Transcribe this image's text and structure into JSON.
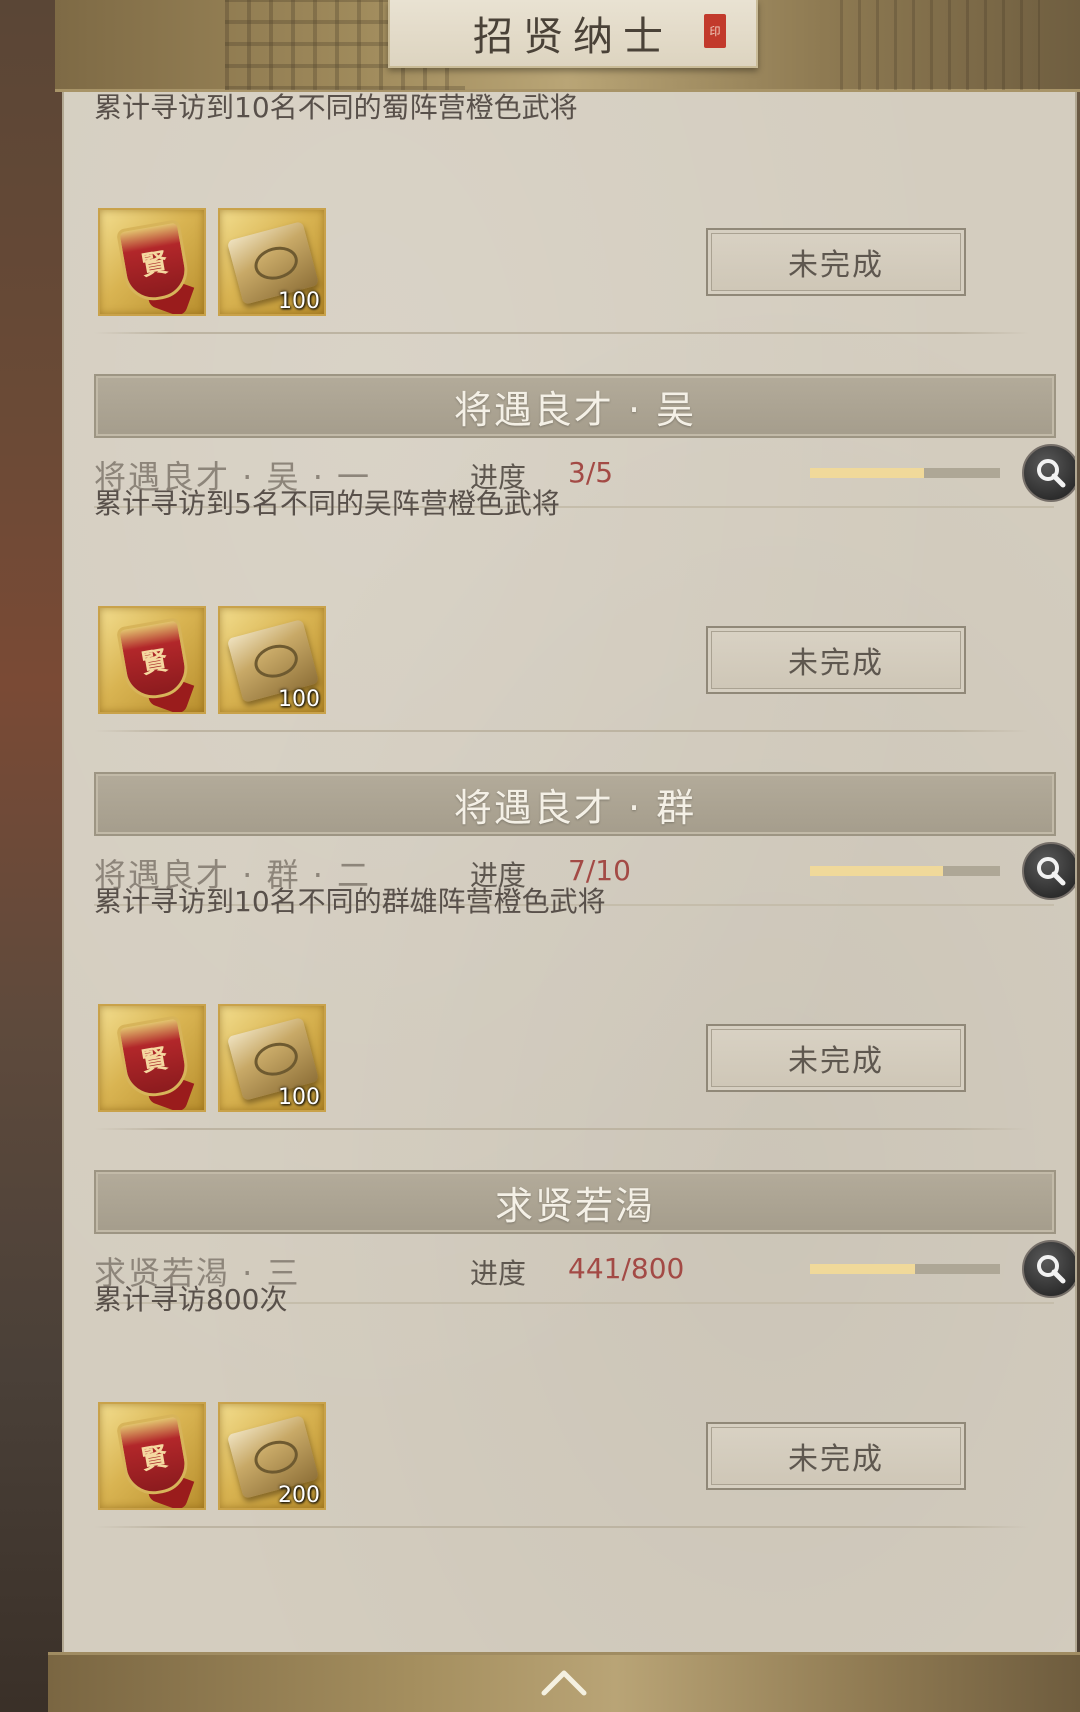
{
  "header": {
    "title": "招贤纳士",
    "seal_text": "印"
  },
  "sections": [
    {
      "description": "累计寻访到10名不同的蜀阵营橙色武将",
      "rewards": [
        {
          "icon": "red-badge-icon",
          "count": ""
        },
        {
          "icon": "gold-scroll-icon",
          "count": "100"
        }
      ],
      "status": "未完成"
    },
    {
      "header": "将遇良才 · 吴",
      "task": "将遇良才 · 吴 · 一",
      "progress_label": "进度",
      "progress_value": "3/5",
      "progress_fraction": 0.6,
      "description": "累计寻访到5名不同的吴阵营橙色武将",
      "rewards": [
        {
          "icon": "red-badge-icon",
          "count": ""
        },
        {
          "icon": "gold-scroll-icon",
          "count": "100"
        }
      ],
      "status": "未完成"
    },
    {
      "header": "将遇良才 · 群",
      "task": "将遇良才 · 群 · 二",
      "progress_label": "进度",
      "progress_value": "7/10",
      "progress_fraction": 0.7,
      "description": "累计寻访到10名不同的群雄阵营橙色武将",
      "rewards": [
        {
          "icon": "red-badge-icon",
          "count": ""
        },
        {
          "icon": "gold-scroll-icon",
          "count": "100"
        }
      ],
      "status": "未完成"
    },
    {
      "header": "求贤若渴",
      "task": "求贤若渴 · 三",
      "progress_label": "进度",
      "progress_value": "441/800",
      "progress_fraction": 0.55,
      "description": "累计寻访800次",
      "rewards": [
        {
          "icon": "red-badge-icon",
          "count": ""
        },
        {
          "icon": "gold-scroll-icon",
          "count": "200"
        }
      ],
      "status": "未完成"
    }
  ],
  "footer": {
    "icon": "chevron-up-icon"
  }
}
